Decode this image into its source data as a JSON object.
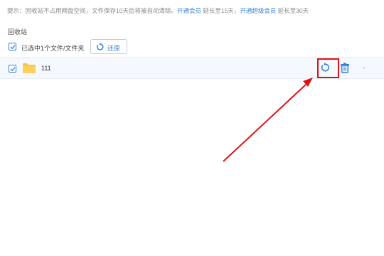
{
  "tip": {
    "prefix": "提示：回收站不占用网盘空间，文件保存10天后将被自动清除。",
    "link_vip": "开通会员",
    "mid": " 延长至15天，",
    "link_svip": "开通超级会员",
    "suffix": " 延长至30天"
  },
  "section_title": "回收站",
  "toolbar": {
    "selected_text": "已选中1个文件/文件夹",
    "restore_label": "还原"
  },
  "rows": [
    {
      "name": "111",
      "extra": "-"
    }
  ],
  "colors": {
    "accent": "#2f7ed8",
    "highlight": "#e01010",
    "folder": "#f7c842"
  }
}
